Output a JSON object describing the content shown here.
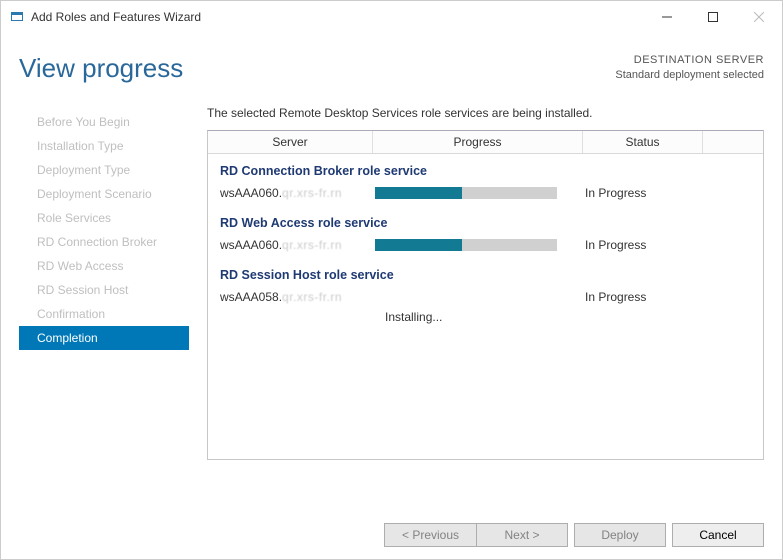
{
  "window": {
    "title": "Add Roles and Features Wizard"
  },
  "header": {
    "page_title": "View progress",
    "dest_label": "DESTINATION SERVER",
    "dest_value": "Standard deployment selected"
  },
  "sidebar": {
    "items": [
      {
        "label": "Before You Begin",
        "active": false
      },
      {
        "label": "Installation Type",
        "active": false
      },
      {
        "label": "Deployment Type",
        "active": false
      },
      {
        "label": "Deployment Scenario",
        "active": false
      },
      {
        "label": "Role Services",
        "active": false
      },
      {
        "label": "RD Connection Broker",
        "active": false
      },
      {
        "label": "RD Web Access",
        "active": false
      },
      {
        "label": "RD Session Host",
        "active": false
      },
      {
        "label": "Confirmation",
        "active": false
      },
      {
        "label": "Completion",
        "active": true
      }
    ]
  },
  "pane": {
    "intro": "The selected Remote Desktop Services role services are being installed.",
    "columns": {
      "server": "Server",
      "progress": "Progress",
      "status": "Status"
    },
    "sections": [
      {
        "title": "RD Connection Broker role service",
        "server": "wsAAA060.",
        "progress_pct": 48,
        "status": "In Progress",
        "subtext": ""
      },
      {
        "title": "RD Web Access role service",
        "server": "wsAAA060.",
        "progress_pct": 48,
        "status": "In Progress",
        "subtext": ""
      },
      {
        "title": "RD Session Host role service",
        "server": "wsAAA058.",
        "progress_pct": 0,
        "status": "In Progress",
        "subtext": "Installing..."
      }
    ]
  },
  "footer": {
    "previous": "< Previous",
    "next": "Next >",
    "deploy": "Deploy",
    "cancel": "Cancel"
  }
}
